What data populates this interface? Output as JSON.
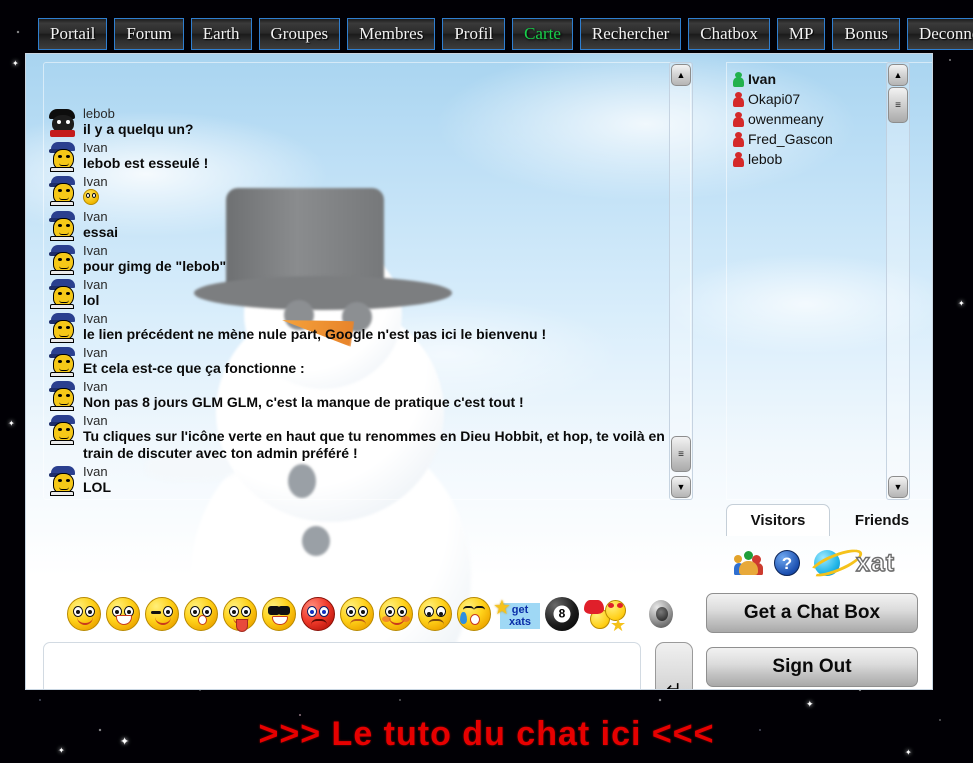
{
  "nav": {
    "items": [
      {
        "label": "Portail",
        "active": false
      },
      {
        "label": "Forum",
        "active": false
      },
      {
        "label": "Earth",
        "active": false
      },
      {
        "label": "Groupes",
        "active": false
      },
      {
        "label": "Membres",
        "active": false
      },
      {
        "label": "Profil",
        "active": false
      },
      {
        "label": "Carte",
        "active": true
      },
      {
        "label": "Rechercher",
        "active": false
      },
      {
        "label": "Chatbox",
        "active": false
      },
      {
        "label": "MP",
        "active": false
      },
      {
        "label": "Bonus",
        "active": false
      },
      {
        "label": "Deconnexion",
        "active": false
      }
    ],
    "active_color": "#17d04a"
  },
  "chat": {
    "messages": [
      {
        "user": "lebob",
        "text": "il y a quelqu un?",
        "avatar": "lebob-avatar",
        "partial": true
      },
      {
        "user": "Ivan",
        "text": "lebob est esseulé !",
        "avatar": "ivan-avatar"
      },
      {
        "user": "Ivan",
        "text": "",
        "avatar": "ivan-avatar",
        "emoticon": "grin-emoticon"
      },
      {
        "user": "Ivan",
        "text": "essai",
        "avatar": "ivan-avatar"
      },
      {
        "user": "Ivan",
        "text": "pour gimg de \"lebob\"",
        "avatar": "ivan-avatar"
      },
      {
        "user": "Ivan",
        "text": "lol",
        "avatar": "ivan-avatar"
      },
      {
        "user": "Ivan",
        "text": "le lien précédent ne mène nule part, Google n'est pas ici le bienvenu !",
        "avatar": "ivan-avatar"
      },
      {
        "user": "Ivan",
        "text": "Et cela est-ce que ça fonctionne :",
        "avatar": "ivan-avatar"
      },
      {
        "user": "Ivan",
        "text": "Non pas 8 jours GLM GLM, c'est la manque de pratique c'est tout !",
        "avatar": "ivan-avatar"
      },
      {
        "user": "Ivan",
        "text": "Tu cliques sur l'icône verte en haut que tu renommes en Dieu Hobbit, et hop, te voilà en train de discuter avec ton admin préféré !",
        "avatar": "ivan-avatar"
      },
      {
        "user": "Ivan",
        "text": "LOL",
        "avatar": "ivan-avatar"
      }
    ]
  },
  "users": {
    "list": [
      {
        "name": "Ivan",
        "status": "green",
        "me": true
      },
      {
        "name": "Okapi07",
        "status": "red",
        "me": false
      },
      {
        "name": "owenmeany",
        "status": "red",
        "me": false
      },
      {
        "name": "Fred_Gascon",
        "status": "red",
        "me": false
      },
      {
        "name": "lebob",
        "status": "red",
        "me": false
      }
    ],
    "status_colors": {
      "online": "#22b14c",
      "away": "#d42a2a"
    }
  },
  "tabs": {
    "visitors": "Visitors",
    "friends": "Friends"
  },
  "brand": {
    "xat_wordmark": "xat",
    "help_glyph": "?"
  },
  "emoticons": [
    {
      "name": "smile-emoticon"
    },
    {
      "name": "grin-emoticon"
    },
    {
      "name": "wink-emoticon"
    },
    {
      "name": "surprised-emoticon"
    },
    {
      "name": "tongue-emoticon"
    },
    {
      "name": "cool-emoticon"
    },
    {
      "name": "angry-emoticon"
    },
    {
      "name": "sad-emoticon"
    },
    {
      "name": "blush-emoticon"
    },
    {
      "name": "frown-emoticon"
    },
    {
      "name": "cry-emoticon"
    }
  ],
  "get_xats": {
    "line1": "get",
    "line2": "xats"
  },
  "eight_ball": {
    "number": "8"
  },
  "input": {
    "value": "",
    "placeholder": ""
  },
  "buttons": {
    "enter": "↵",
    "get_chat_box": "Get a Chat Box",
    "sign_out": "Sign Out"
  },
  "scrollbars": {
    "up_glyph": "▲",
    "down_glyph": "▼",
    "thumb_glyph": "≡"
  },
  "banner": {
    "text": ">>> Le tuto du chat ici <<<",
    "color": "#e60000"
  }
}
